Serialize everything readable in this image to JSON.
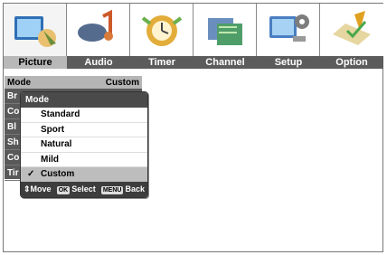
{
  "tabs": [
    {
      "label": "Picture",
      "icon": "picture-icon",
      "active": true
    },
    {
      "label": "Audio",
      "icon": "audio-icon",
      "active": false
    },
    {
      "label": "Timer",
      "icon": "timer-icon",
      "active": false
    },
    {
      "label": "Channel",
      "icon": "channel-icon",
      "active": false
    },
    {
      "label": "Setup",
      "icon": "setup-icon",
      "active": false
    },
    {
      "label": "Option",
      "icon": "option-icon",
      "active": false
    }
  ],
  "menu": {
    "mode_label": "Mode",
    "mode_value": "Custom",
    "row_prefixes": [
      "Br",
      "Co",
      "Bl",
      "Sh",
      "Co",
      "Tir"
    ]
  },
  "popup": {
    "title": "Mode",
    "options": [
      "Standard",
      "Sport",
      "Natural",
      "Mild",
      "Custom"
    ],
    "selected": "Custom",
    "check_glyph": "✓",
    "footer": {
      "move_glyph": "⇕",
      "move_label": "Move",
      "ok_key": "OK",
      "select_label": "Select",
      "menu_key": "MENU",
      "back_label": "Back"
    }
  },
  "colors": {
    "active_tab": "#b8b8b8",
    "tab_bar": "#5c5c5c",
    "popup_header": "#4a4a4a",
    "highlight": "#bdbdbd"
  }
}
